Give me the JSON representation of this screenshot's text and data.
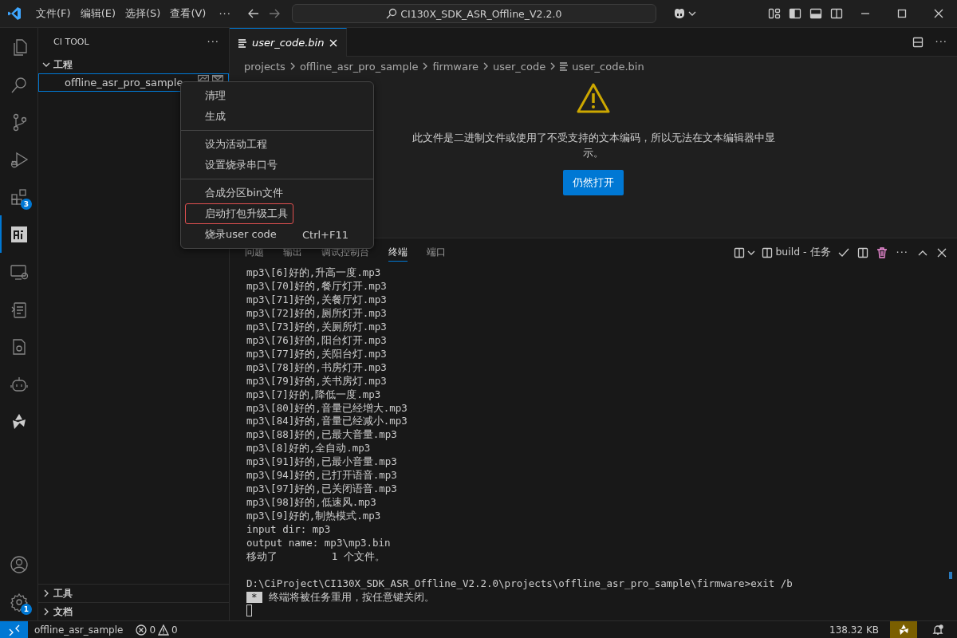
{
  "title_bar": {
    "menus": [
      "文件(F)",
      "编辑(E)",
      "选择(S)",
      "查看(V)"
    ],
    "more": "···",
    "search": "CI130X_SDK_ASR_Offline_V2.2.0"
  },
  "activity_bar": {
    "items": [
      {
        "kind": "files",
        "selected": false
      },
      {
        "kind": "search",
        "selected": false
      },
      {
        "kind": "git",
        "selected": false
      },
      {
        "kind": "debug",
        "selected": false
      },
      {
        "kind": "extensions",
        "selected": false,
        "badge": "3"
      },
      {
        "kind": "citool",
        "selected": true
      },
      {
        "kind": "remote",
        "selected": false
      },
      {
        "kind": "tasks",
        "selected": false
      },
      {
        "kind": "chip",
        "selected": false
      },
      {
        "kind": "robot",
        "selected": false
      },
      {
        "kind": "star",
        "selected": false
      }
    ],
    "bottom": [
      {
        "kind": "account",
        "selected": false
      },
      {
        "kind": "settings",
        "selected": false,
        "badge": "1"
      }
    ]
  },
  "sidebar": {
    "title": "CI TOOL",
    "more": "···",
    "sections": [
      {
        "label": "工程",
        "expanded": true,
        "items": [
          {
            "label": "offline_asr_pro_sample",
            "selected": true
          }
        ]
      },
      {
        "label": "工具",
        "expanded": false
      },
      {
        "label": "文档",
        "expanded": false
      }
    ]
  },
  "editor": {
    "tabs": [
      {
        "label": "user_code.bin",
        "selected": true
      }
    ],
    "breadcrumbs": [
      "projects",
      "offline_asr_pro_sample",
      "firmware",
      "user_code",
      "user_code.bin"
    ],
    "more": "···",
    "message": "此文件是二进制文件或使用了不受支持的文本编码，所以无法在文本编辑器中显示。",
    "button": "仍然打开"
  },
  "context_menu": {
    "groups": [
      [
        {
          "label": "清理",
          "highlighted": false
        },
        {
          "label": "生成",
          "highlighted": false
        }
      ],
      [
        {
          "label": "设为活动工程",
          "highlighted": false
        },
        {
          "label": "设置烧录串口号",
          "highlighted": false
        }
      ],
      [
        {
          "label": "合成分区bin文件",
          "highlighted": false
        },
        {
          "label": "启动打包升级工具",
          "highlighted": true
        },
        {
          "label": "烧录user code",
          "shortcut": "Ctrl+F11",
          "highlighted": false
        }
      ]
    ]
  },
  "panel": {
    "tabs": [
      {
        "label": "问题",
        "selected": false
      },
      {
        "label": "输出",
        "selected": false
      },
      {
        "label": "调试控制台",
        "selected": false
      },
      {
        "label": "终端",
        "selected": true
      },
      {
        "label": "端口",
        "selected": false
      }
    ],
    "task": "build - 任务",
    "more": "···",
    "lines": [
      {
        "kind": "output",
        "text": "mp3\\[6]好的,升高一度.mp3"
      },
      {
        "kind": "output",
        "text": "mp3\\[70]好的,餐厅灯开.mp3"
      },
      {
        "kind": "output",
        "text": "mp3\\[71]好的,关餐厅灯.mp3"
      },
      {
        "kind": "output",
        "text": "mp3\\[72]好的,厕所灯开.mp3"
      },
      {
        "kind": "output",
        "text": "mp3\\[73]好的,关厕所灯.mp3"
      },
      {
        "kind": "output",
        "text": "mp3\\[76]好的,阳台灯开.mp3"
      },
      {
        "kind": "output",
        "text": "mp3\\[77]好的,关阳台灯.mp3"
      },
      {
        "kind": "output",
        "text": "mp3\\[78]好的,书房灯开.mp3"
      },
      {
        "kind": "output",
        "text": "mp3\\[79]好的,关书房灯.mp3"
      },
      {
        "kind": "output",
        "text": "mp3\\[7]好的,降低一度.mp3"
      },
      {
        "kind": "output",
        "text": "mp3\\[80]好的,音量已经增大.mp3"
      },
      {
        "kind": "output",
        "text": "mp3\\[84]好的,音量已经减小.mp3"
      },
      {
        "kind": "output",
        "text": "mp3\\[88]好的,已最大音量.mp3"
      },
      {
        "kind": "output",
        "text": "mp3\\[8]好的,全自动.mp3"
      },
      {
        "kind": "output",
        "text": "mp3\\[91]好的,已最小音量.mp3"
      },
      {
        "kind": "output",
        "text": "mp3\\[94]好的,已打开语音.mp3"
      },
      {
        "kind": "output",
        "text": "mp3\\[97]好的,已关闭语音.mp3"
      },
      {
        "kind": "output",
        "text": "mp3\\[98]好的,低速风.mp3"
      },
      {
        "kind": "output",
        "text": "mp3\\[9]好的,制热模式.mp3"
      },
      {
        "kind": "output",
        "text": "input dir: mp3"
      },
      {
        "kind": "output",
        "text": "output name: mp3\\mp3.bin"
      },
      {
        "kind": "output",
        "text": "移动了         1 个文件。"
      },
      {
        "kind": "prompt",
        "text": "D:\\CiProject\\CI130X_SDK_ASR_Offline_V2.2.0\\projects\\offline_asr_pro_sample\\firmware>exit /b"
      },
      {
        "kind": "notice",
        "mark": "*",
        "text": "终端将被任务重用，按任意键关闭。"
      }
    ]
  },
  "status_bar": {
    "project": "offline_asr_sample",
    "errors": "0",
    "warnings": "0",
    "size": "138.32 KB"
  }
}
